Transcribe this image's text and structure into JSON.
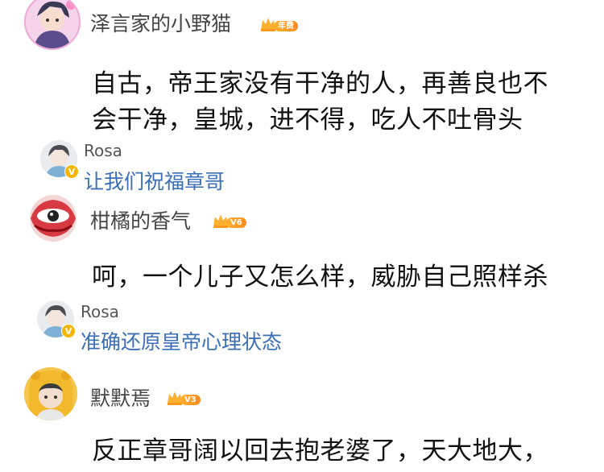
{
  "comments": [
    {
      "username": "泽言家的小野猫",
      "badge_level": "年费",
      "text_lines": [
        "自古，帝王家没有干净的人，再善良也不",
        "会干净，皇城，进不得，吃人不吐骨头"
      ],
      "avatar_icon": "anime-boy-avatar",
      "reply": {
        "username": "Rosa",
        "text": "让我们祝福章哥",
        "avatar_icon": "rosa-avatar"
      }
    },
    {
      "username": "柑橘的香气",
      "badge_level": "V6",
      "text_lines": [
        "呵，一个儿子又怎么样，威胁自己照样杀"
      ],
      "avatar_icon": "red-eye-avatar",
      "reply": {
        "username": "Rosa",
        "text": "准确还原皇帝心理状态",
        "avatar_icon": "rosa-avatar"
      }
    },
    {
      "username": "默默焉",
      "badge_level": "V3",
      "text_lines": [
        "反正章哥阔以回去抱老婆了，天大地大，"
      ],
      "avatar_icon": "hooded-person-avatar"
    }
  ],
  "colors": {
    "reply_text": "#3b6fb6",
    "badge_gold": "#ffb02e",
    "verified_yellow": "#f6b600"
  }
}
